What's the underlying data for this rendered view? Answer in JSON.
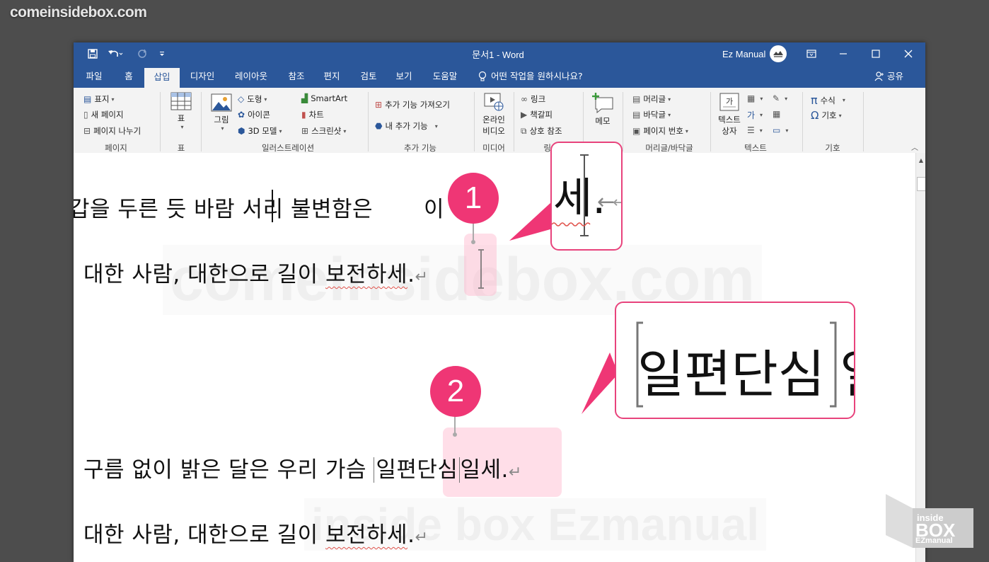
{
  "site_watermark": "comeinsidebox.com",
  "window": {
    "title": "문서1 - Word",
    "user": "Ez Manual",
    "controls": [
      "ribbon-display",
      "minimize",
      "maximize",
      "close"
    ]
  },
  "tabs": [
    {
      "label": "파일"
    },
    {
      "label": "홈"
    },
    {
      "label": "삽입",
      "active": true
    },
    {
      "label": "디자인"
    },
    {
      "label": "레이아웃"
    },
    {
      "label": "참조"
    },
    {
      "label": "편지"
    },
    {
      "label": "검토"
    },
    {
      "label": "보기"
    },
    {
      "label": "도움말"
    }
  ],
  "tell_me": "어떤 작업을 원하시나요?",
  "share": "공유",
  "ribbon": {
    "pages": {
      "label": "페이지",
      "items": [
        "표지",
        "새 페이지",
        "페이지 나누기"
      ]
    },
    "table": {
      "label": "표",
      "button": "표"
    },
    "illustrations": {
      "label": "일러스트레이션",
      "picture": "그림",
      "items": [
        "도형",
        "아이콘",
        "3D 모델"
      ],
      "items2": [
        "SmartArt",
        "차트",
        "스크린샷"
      ]
    },
    "addins": {
      "label": "추가 기능",
      "items": [
        "추가 기능 가져오기",
        "내 추가 기능"
      ]
    },
    "media": {
      "label": "미디어",
      "button_line1": "온라인",
      "button_line2": "비디오"
    },
    "links": {
      "label": "링크",
      "items": [
        "링크",
        "책갈피",
        "상호 참조"
      ]
    },
    "comments": {
      "label": "메모",
      "button": "메모"
    },
    "header_footer": {
      "label": "머리글/바닥글",
      "items": [
        "머리글",
        "바닥글",
        "페이지 번호"
      ]
    },
    "text": {
      "label": "텍스트",
      "button_line1": "텍스트",
      "button_line2": "상자"
    },
    "symbols": {
      "label": "기호",
      "items": [
        "수식",
        "기호"
      ]
    }
  },
  "document": {
    "line1": "갑을 두른 듯 바람 서리 불변함은",
    "line1_tail": "이 기",
    "line2_prefix": "대한 사람, 대한으로 길이 ",
    "line2_word": "보전하세",
    "line3_prefix": "구름 없이 밝은 달은 우리 가슴 ",
    "line3_word": "일편단심",
    "line3_suffix": "일세.",
    "line4_prefix": "대한 사람, 대한으로 길이 ",
    "line4_word": "보전하세",
    "period": ".",
    "para_mark": "↵"
  },
  "callouts": {
    "one": {
      "number": "1",
      "text": "세.",
      "arrow": "←",
      "mark": "↵"
    },
    "two": {
      "number": "2",
      "text": "일편단심",
      "tail": "일"
    }
  },
  "watermarks": [
    "comeinsidebox.com",
    "inside box Ezmanual"
  ],
  "logo": {
    "line1": "inside",
    "line2": "BOX",
    "line3": "EZmanual"
  },
  "colors": {
    "word_blue": "#2b579a",
    "highlight": "#ef3675",
    "ribbon_bg": "#f3f3f3"
  }
}
